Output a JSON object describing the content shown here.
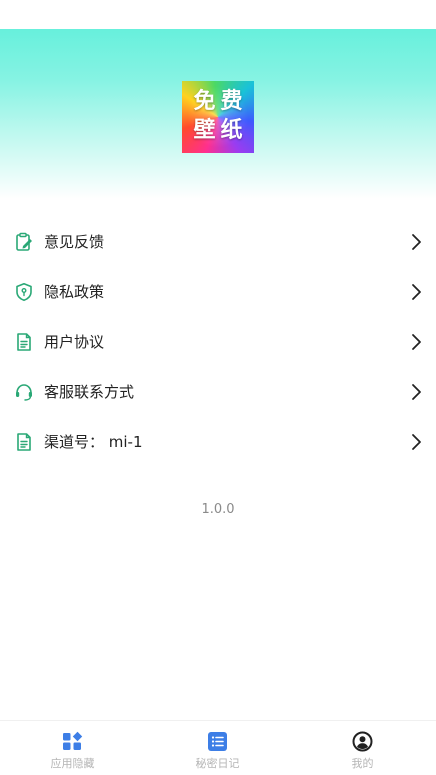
{
  "header": {
    "logo_text": "免费壁纸"
  },
  "menu": {
    "items": [
      {
        "label": "意见反馈",
        "icon": "feedback-clipboard-icon"
      },
      {
        "label": "隐私政策",
        "icon": "privacy-shield-icon"
      },
      {
        "label": "用户协议",
        "icon": "document-icon"
      },
      {
        "label": "客服联系方式",
        "icon": "headset-icon"
      },
      {
        "label": "渠道号：  mi-1",
        "icon": "document-icon"
      }
    ]
  },
  "version": "1.0.0",
  "tabbar": {
    "tabs": [
      {
        "label": "应用隐藏",
        "icon": "apps-grid-icon"
      },
      {
        "label": "秘密日记",
        "icon": "list-note-icon"
      },
      {
        "label": "我的",
        "icon": "user-circle-icon"
      }
    ]
  },
  "colors": {
    "accent_green": "#2aa876",
    "tab_icon_blue": "#3d7ee6",
    "tab_icon_dark": "#222222",
    "tab_label_gray": "#b5b5b5",
    "header_teal": "#67f0dc"
  }
}
